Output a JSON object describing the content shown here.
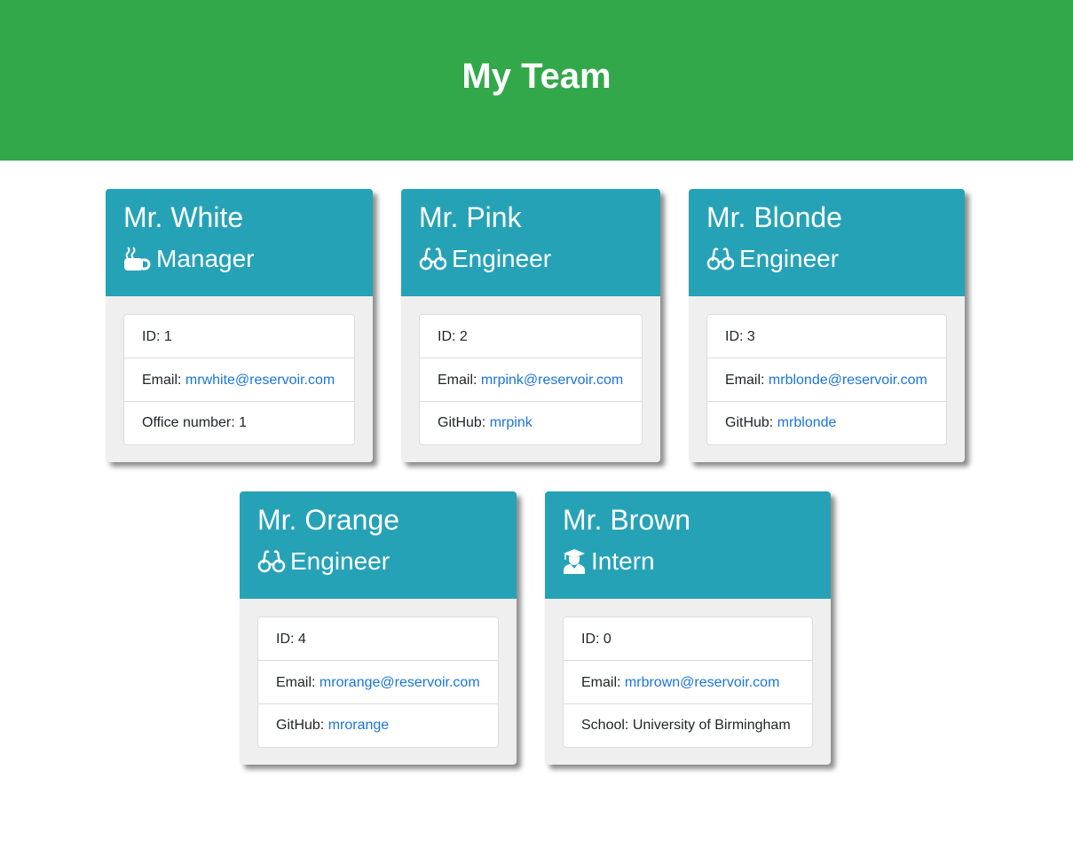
{
  "header": {
    "title": "My Team"
  },
  "team": [
    {
      "name": "Mr. White",
      "role": "Manager",
      "role_icon": "coffee-mug-icon",
      "id_label": "ID:",
      "id": "1",
      "email_label": "Email:",
      "email": "mrwhite@reservoir.com",
      "extra_label": "Office number:",
      "extra_value": "1"
    },
    {
      "name": "Mr. Pink",
      "role": "Engineer",
      "role_icon": "glasses-icon",
      "id_label": "ID:",
      "id": "2",
      "email_label": "Email:",
      "email": "mrpink@reservoir.com",
      "extra_label": "GitHub:",
      "extra_value": "mrpink"
    },
    {
      "name": "Mr. Blonde",
      "role": "Engineer",
      "role_icon": "glasses-icon",
      "id_label": "ID:",
      "id": "3",
      "email_label": "Email:",
      "email": "mrblonde@reservoir.com",
      "extra_label": "GitHub:",
      "extra_value": "mrblonde"
    },
    {
      "name": "Mr. Orange",
      "role": "Engineer",
      "role_icon": "glasses-icon",
      "id_label": "ID:",
      "id": "4",
      "email_label": "Email:",
      "email": "mrorange@reservoir.com",
      "extra_label": "GitHub:",
      "extra_value": "mrorange"
    },
    {
      "name": "Mr. Brown",
      "role": "Intern",
      "role_icon": "graduate-icon",
      "id_label": "ID:",
      "id": "0",
      "email_label": "Email:",
      "email": "mrbrown@reservoir.com",
      "extra_label": "School:",
      "extra_value": "University of Birmingham"
    }
  ],
  "colors": {
    "header_bg": "#33a84a",
    "card_header_bg": "#26a2b7",
    "link": "#1a75d9"
  }
}
